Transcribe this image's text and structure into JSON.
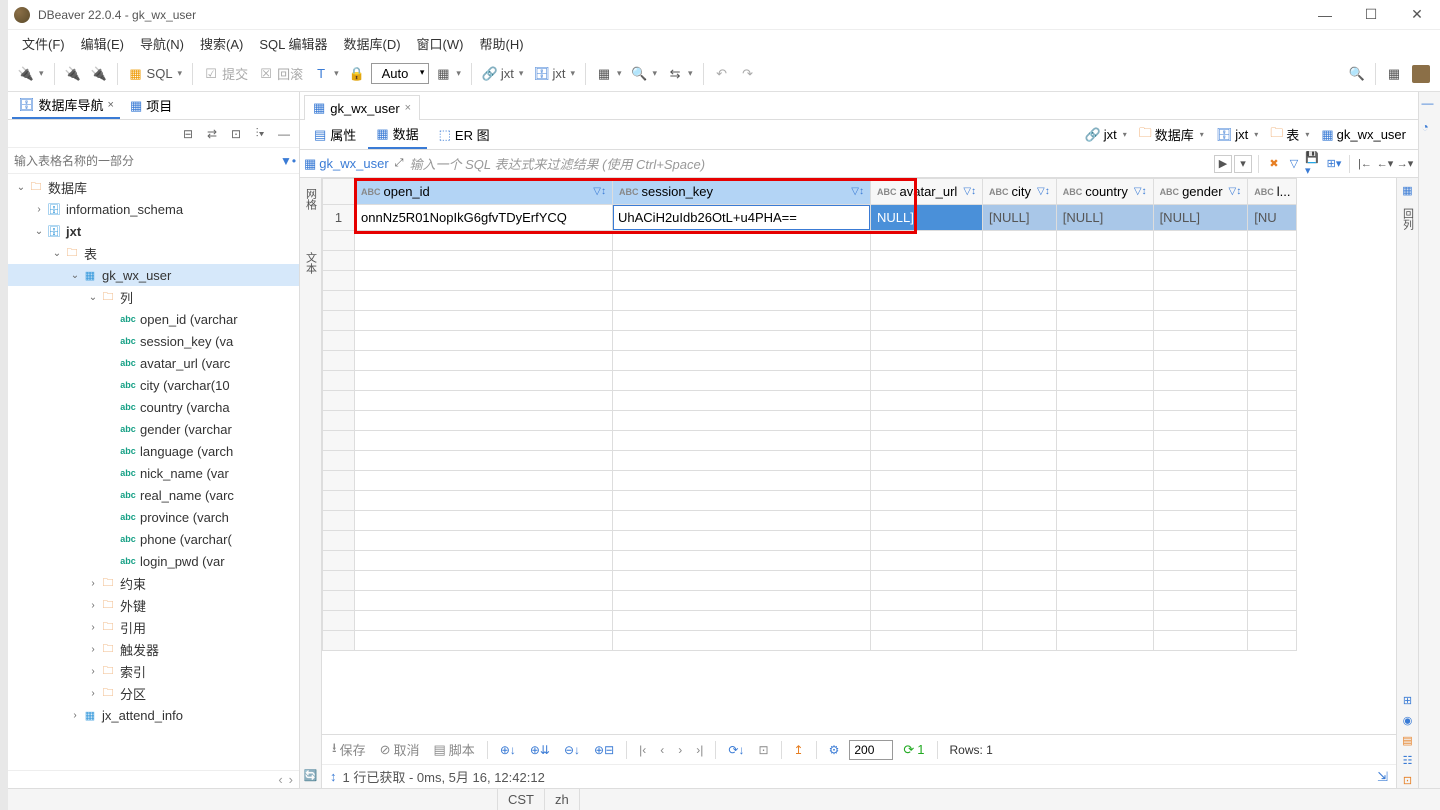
{
  "window": {
    "title": "DBeaver 22.0.4 - gk_wx_user"
  },
  "menu": [
    "文件(F)",
    "编辑(E)",
    "导航(N)",
    "搜索(A)",
    "SQL 编辑器",
    "数据库(D)",
    "窗口(W)",
    "帮助(H)"
  ],
  "toolbar": {
    "sql": "SQL",
    "commit": "提交",
    "rollback": "回滚",
    "autoCombo": "Auto",
    "jxt": "jxt",
    "jxt2": "jxt"
  },
  "navTabs": {
    "nav": "数据库导航",
    "proj": "项目"
  },
  "filterPlaceholder": "输入表格名称的一部分",
  "tree": {
    "db": "数据库",
    "info_schema": "information_schema",
    "jxt": "jxt",
    "tables": "表",
    "gk_wx_user": "gk_wx_user",
    "cols": "列",
    "columns": [
      "open_id (varchar",
      "session_key (va",
      "avatar_url (varc",
      "city (varchar(10",
      "country (varcha",
      "gender (varchar",
      "language (varch",
      "nick_name (var",
      "real_name (varc",
      "province (varch",
      "phone (varchar(",
      "login_pwd (var"
    ],
    "constraints": "约束",
    "fkeys": "外键",
    "refs": "引用",
    "triggers": "触发器",
    "indexes": "索引",
    "partitions": "分区",
    "jx_attend": "jx_attend_info"
  },
  "editorTab": "gk_wx_user",
  "subtabs": {
    "props": "属性",
    "data": "数据",
    "er": "ER 图"
  },
  "breadcrumb": {
    "jxt": "jxt",
    "db": "数据库",
    "jxt2": "jxt",
    "tbl": "表",
    "gk": "gk_wx_user"
  },
  "filterbar": {
    "label": "gk_wx_user",
    "hint": "输入一个 SQL 表达式来过滤结果 (使用 Ctrl+Space)"
  },
  "columns": [
    "open_id",
    "session_key",
    "avatar_url",
    "city",
    "country",
    "gender",
    "l..."
  ],
  "row": {
    "n": "1",
    "open_id": "onnNz5R01NopIkG6gfvTDyErfYCQ",
    "session_key": "UhACiH2uIdb26OtL+u4PHA==",
    "avatar_url": "NULL]",
    "city": "[NULL]",
    "country": "[NULL]",
    "gender": "[NULL]",
    "last": "[NU"
  },
  "footer": {
    "save": "保存",
    "cancel": "取消",
    "script": "脚本",
    "pagesize": "200",
    "rows": "Rows: 1",
    "one": "1"
  },
  "status": "1 行已获取 - 0ms, 5月 16, 12:42:12",
  "statusbar": {
    "tz": "CST",
    "lang": "zh"
  },
  "vtabs": {
    "grid": "网格",
    "text": "文本"
  },
  "rightVtab": "回列"
}
